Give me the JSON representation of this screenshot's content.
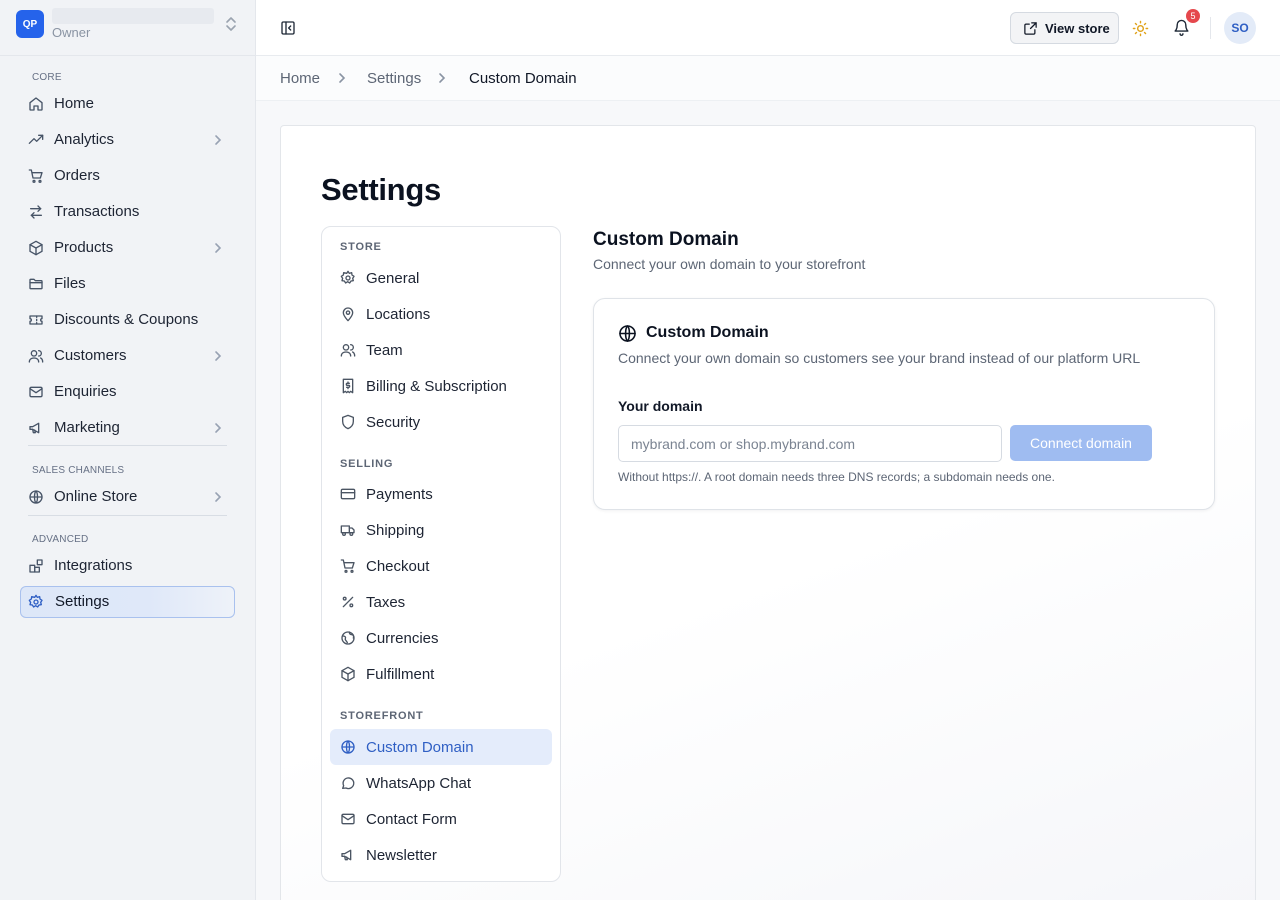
{
  "workspace": {
    "logo_initials": "QP",
    "role": "Owner"
  },
  "sidebar": {
    "sections": {
      "core": "CORE",
      "sales_channels": "SALES CHANNELS",
      "advanced": "ADVANCED"
    },
    "items": [
      {
        "label": "Home",
        "icon": "home-icon"
      },
      {
        "label": "Analytics",
        "icon": "trending-up-icon",
        "expandable": true
      },
      {
        "label": "Orders",
        "icon": "cart-icon"
      },
      {
        "label": "Transactions",
        "icon": "arrows-swap-icon"
      },
      {
        "label": "Products",
        "icon": "box-icon",
        "expandable": true
      },
      {
        "label": "Files",
        "icon": "folder-icon"
      },
      {
        "label": "Discounts & Coupons",
        "icon": "ticket-icon"
      },
      {
        "label": "Customers",
        "icon": "users-icon",
        "expandable": true
      },
      {
        "label": "Enquiries",
        "icon": "mail-icon"
      },
      {
        "label": "Marketing",
        "icon": "megaphone-icon",
        "expandable": true
      },
      {
        "label": "Online Store",
        "icon": "globe-icon",
        "expandable": true
      },
      {
        "label": "Integrations",
        "icon": "blocks-icon"
      },
      {
        "label": "Settings",
        "icon": "gear-icon",
        "active": true
      }
    ]
  },
  "topbar": {
    "view_store_label": "View store",
    "notification_count": "5",
    "avatar_initials": "SO"
  },
  "breadcrumb": [
    "Home",
    "Settings",
    "Custom Domain"
  ],
  "page": {
    "title": "Settings"
  },
  "settings_nav": {
    "sections": {
      "store": "STORE",
      "selling": "SELLING",
      "storefront": "STOREFRONT"
    },
    "store_items": [
      "General",
      "Locations",
      "Team",
      "Billing & Subscription",
      "Security"
    ],
    "selling_items": [
      "Payments",
      "Shipping",
      "Checkout",
      "Taxes",
      "Currencies",
      "Fulfillment"
    ],
    "storefront_items": [
      "Custom Domain",
      "WhatsApp Chat",
      "Contact Form",
      "Newsletter"
    ],
    "active": "Custom Domain"
  },
  "content": {
    "title": "Custom Domain",
    "subtitle": "Connect your own domain to your storefront",
    "card": {
      "title": "Custom Domain",
      "description": "Connect your own domain so customers see your brand instead of our platform URL",
      "field_label": "Your domain",
      "input_value": "",
      "input_placeholder": "mybrand.com or shop.mybrand.com",
      "button_label": "Connect domain",
      "help_text": "Without https://. A root domain needs three DNS records; a subdomain needs one."
    }
  },
  "colors": {
    "accent": "#2563eb",
    "active_nav_bg": "#e4ecfb",
    "button_disabled": "#9fbcf1",
    "badge": "#e5484d",
    "sun": "#e0a21a"
  }
}
